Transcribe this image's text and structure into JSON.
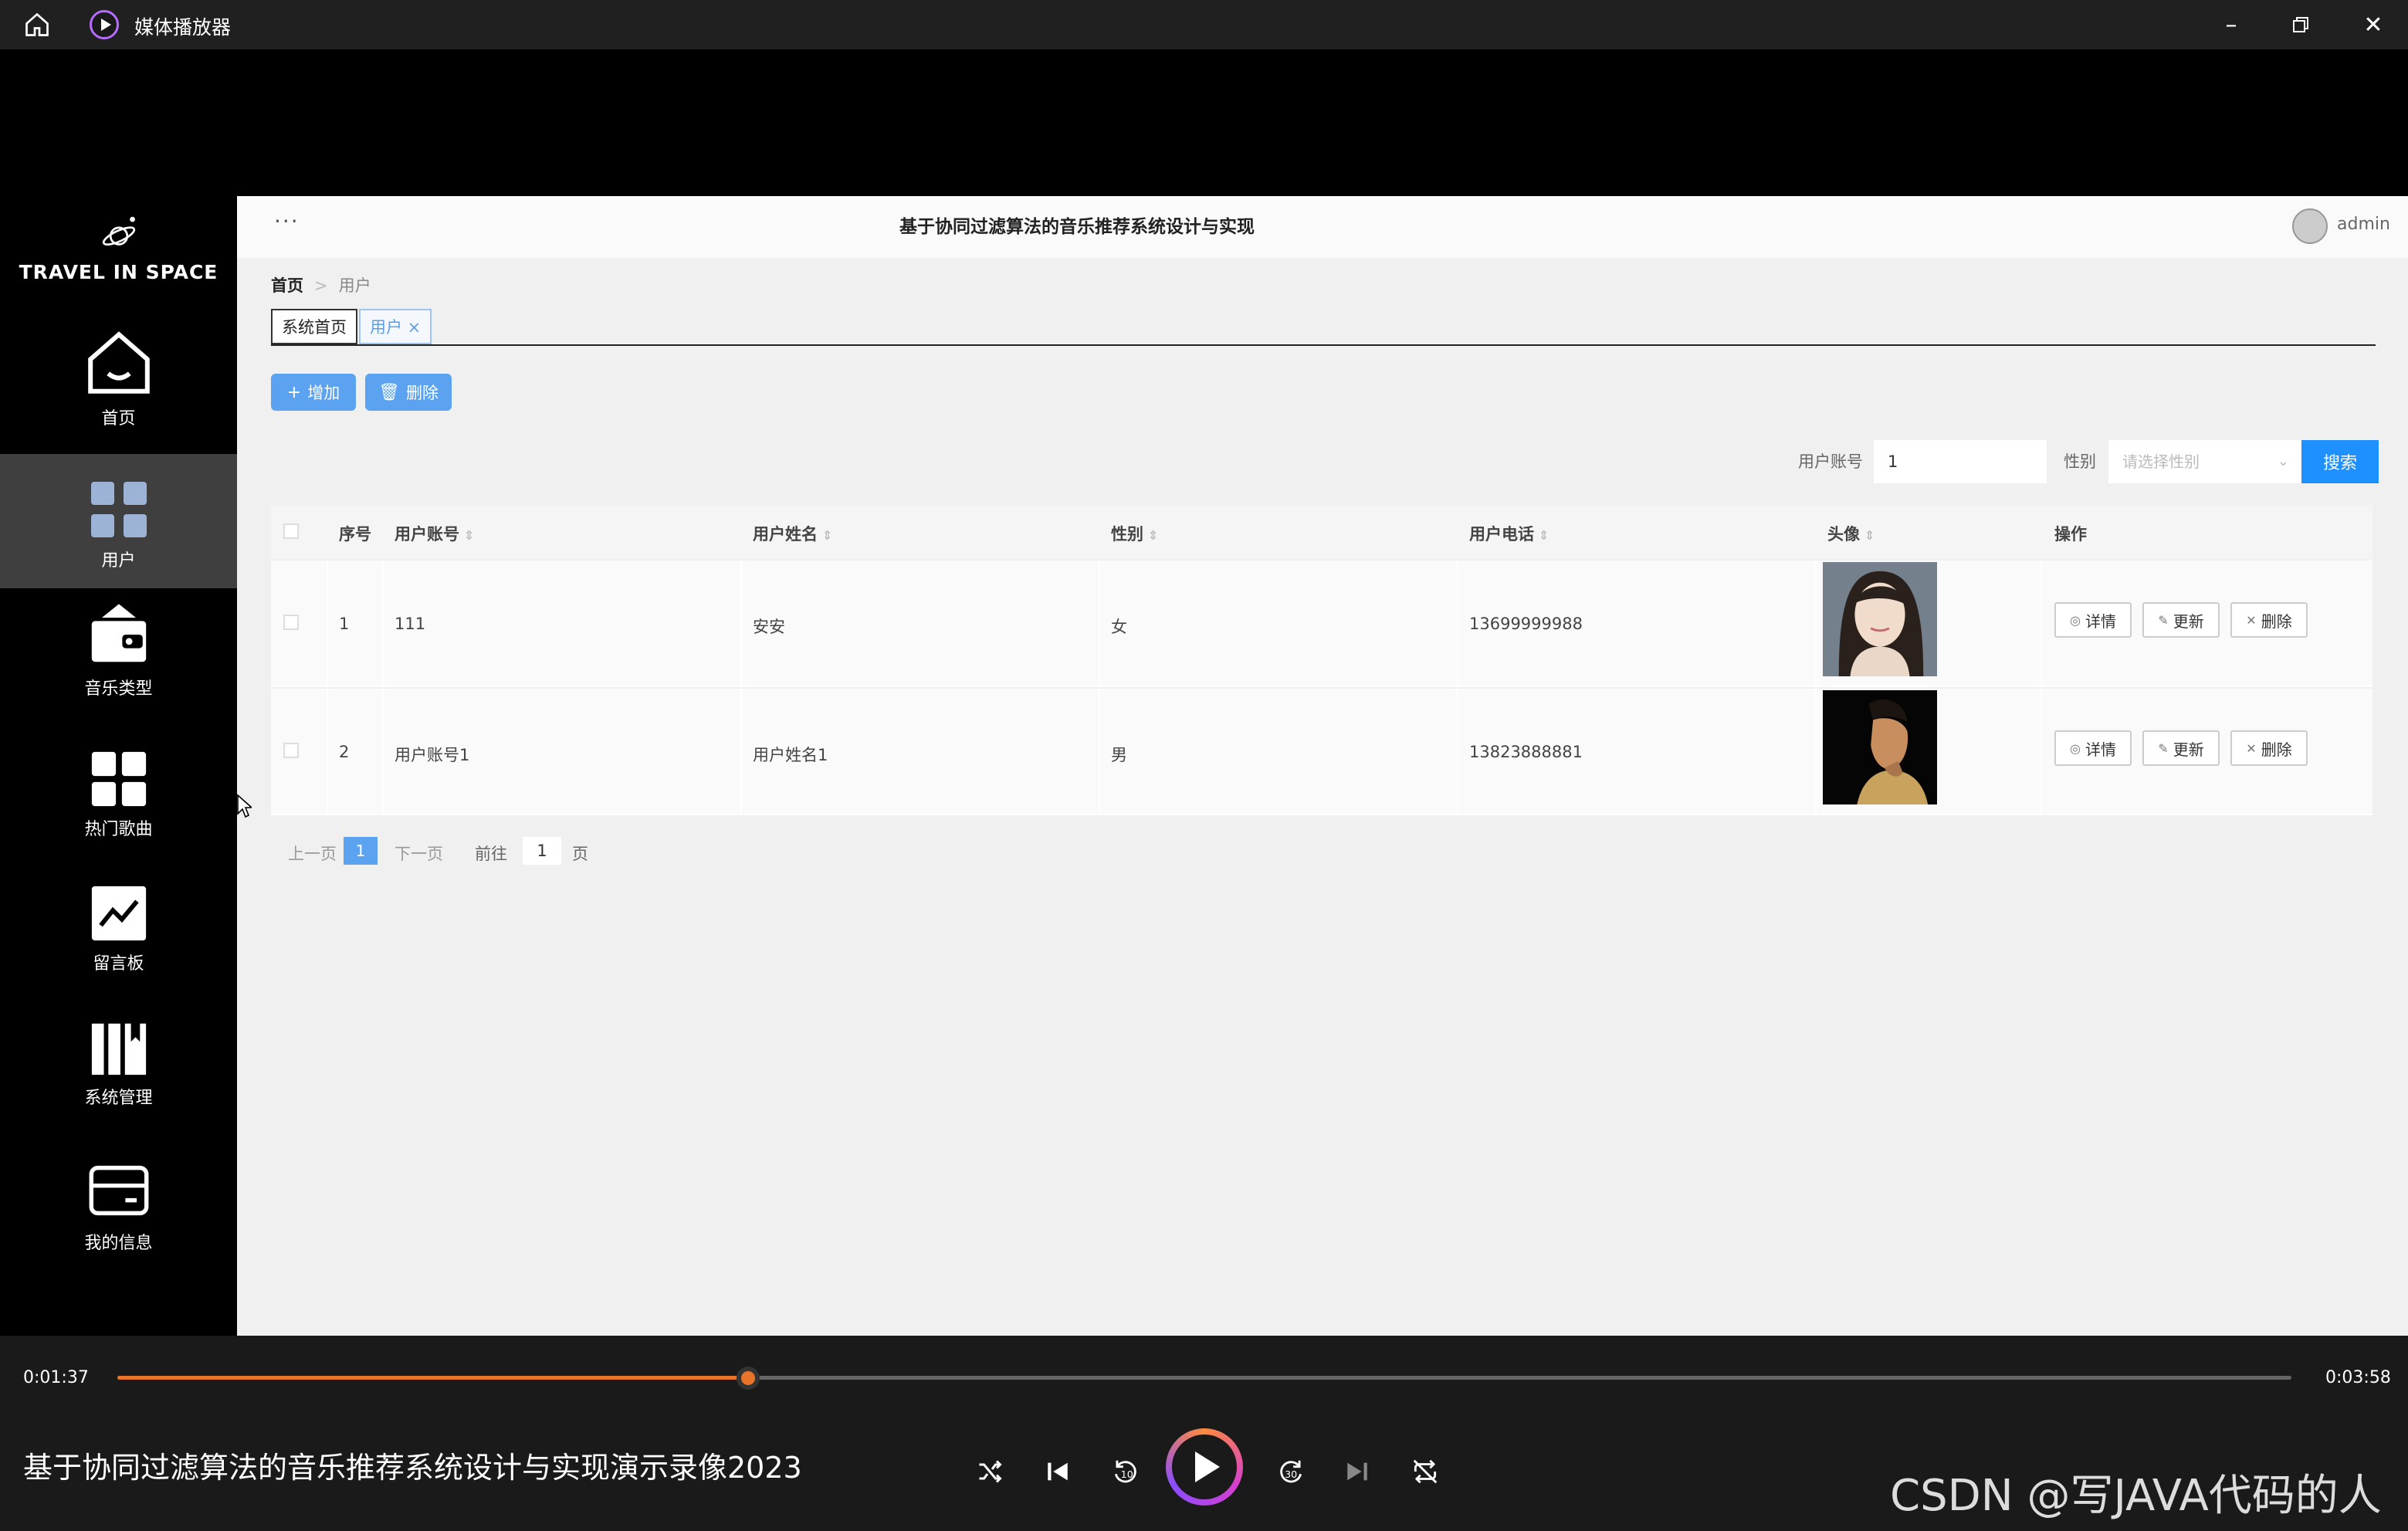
{
  "window": {
    "app_title": "媒体播放器",
    "controls": [
      "minimize-icon",
      "restore-icon",
      "close-icon"
    ]
  },
  "sidebar": {
    "logo_text": "TRAVEL IN SPACE",
    "items": [
      {
        "label": "首页",
        "icon": "home-icon",
        "active": false
      },
      {
        "label": "用户",
        "icon": "grid-icon",
        "active": true
      },
      {
        "label": "音乐类型",
        "icon": "wallet-icon",
        "active": false
      },
      {
        "label": "热门歌曲",
        "icon": "apps-icon",
        "active": false
      },
      {
        "label": "留言板",
        "icon": "chart-icon",
        "active": false
      },
      {
        "label": "系统管理",
        "icon": "book-icon",
        "active": false
      },
      {
        "label": "我的信息",
        "icon": "card-icon",
        "active": false
      }
    ]
  },
  "header": {
    "menu_dots": "···",
    "title": "基于协同过滤算法的音乐推荐系统设计与实现",
    "username": "admin"
  },
  "breadcrumb": {
    "home": "首页",
    "separator": ">",
    "current": "用户"
  },
  "tabs": [
    {
      "label": "系统首页"
    },
    {
      "label": "用户 ×"
    }
  ],
  "toolbar": {
    "add_label": "增加",
    "delete_label": "删除"
  },
  "search": {
    "account_label": "用户账号",
    "account_value": "1",
    "gender_label": "性别",
    "gender_placeholder": "请选择性别",
    "button_label": "搜索"
  },
  "table": {
    "headers": [
      "序号",
      "用户账号",
      "用户姓名",
      "性别",
      "用户电话",
      "头像",
      "操作"
    ],
    "rows": [
      {
        "index": "1",
        "account": "111",
        "name": "安安",
        "gender": "女",
        "phone": "13699999988",
        "avatar": "female-portrait"
      },
      {
        "index": "2",
        "account": "用户账号1",
        "name": "用户姓名1",
        "gender": "男",
        "phone": "13823888881",
        "avatar": "male-portrait"
      }
    ],
    "actions": {
      "detail": "详情",
      "update": "更新",
      "delete": "删除"
    }
  },
  "pagination": {
    "prev": "上一页",
    "current": "1",
    "next": "下一页",
    "goto_label": "前往",
    "goto_value": "1",
    "page_suffix": "页"
  },
  "player": {
    "elapsed": "0:01:37",
    "duration": "0:03:58",
    "progress": 0.29,
    "video_title": "基于协同过滤算法的音乐推荐系统设计与实现演示录像2023",
    "accent_color": "#e8742a",
    "watermark": "CSDN @写JAVA代码的人"
  }
}
